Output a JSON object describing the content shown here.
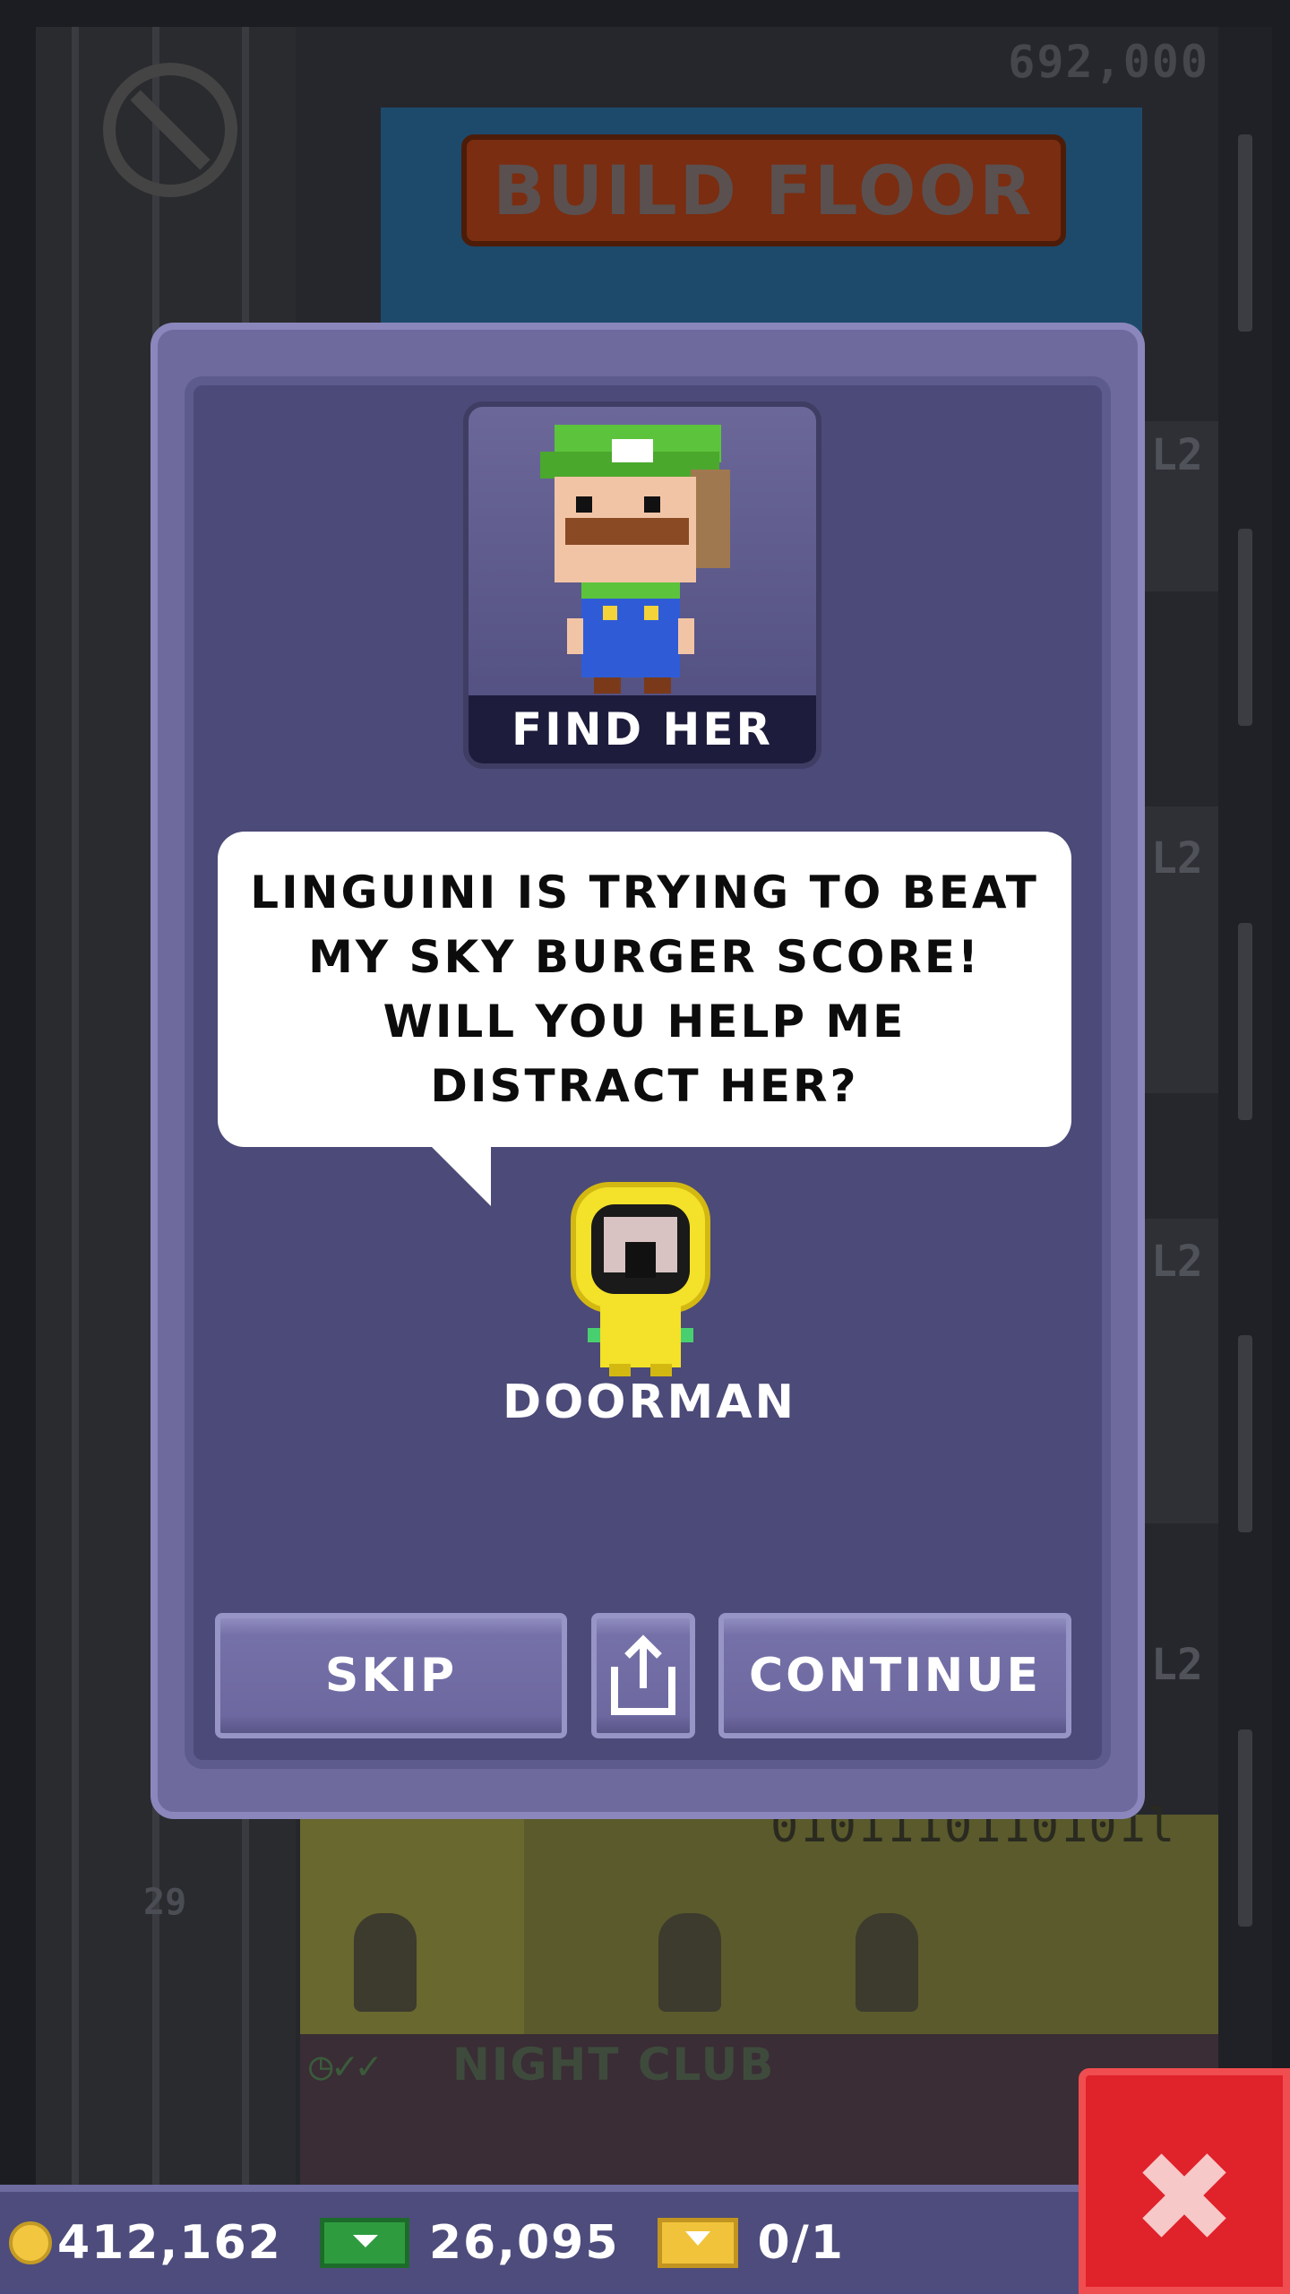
{
  "background": {
    "top_value": "692,000",
    "build_button_label": "BUILD FLOOR",
    "floor_tags": [
      "L2",
      "L2",
      "L2",
      "L2"
    ],
    "floor_number": "29",
    "binary_sign": "0101110110101l",
    "nightclub_label": "NIGHT CLUB"
  },
  "dialog": {
    "portrait_label": "FIND HER",
    "speech": "LINGUINI IS TRYING TO BEAT\nMY SKY BURGER SCORE!\nWILL YOU HELP ME\nDISTRACT HER?",
    "role_label": "DOORMAN",
    "skip_label": "SKIP",
    "continue_label": "CONTINUE",
    "share_icon": "share-icon"
  },
  "bottom_bar": {
    "coins": "412,162",
    "bux": "26,095",
    "tickets": "0/1",
    "close_icon": "close-icon"
  },
  "colors": {
    "dialog_bg": "#4c4a78",
    "dialog_border": "#6f6a9e",
    "close_button": "#e0222b",
    "coin": "#f3c640",
    "bux": "#2e9b3f",
    "ticket": "#f1c33a"
  }
}
